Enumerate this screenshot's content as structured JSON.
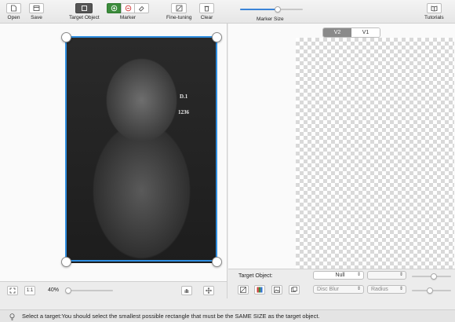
{
  "toolbar": {
    "open_label": "Open",
    "save_label": "Save",
    "target_object_label": "Target Object",
    "marker_label": "Marker",
    "fine_tuning_label": "Fine-tuning",
    "clear_label": "Clear",
    "marker_size_label": "Marker Size",
    "tutorials_label": "Tutorials",
    "marker_size_value": 0.6
  },
  "canvas": {
    "photo_labels": [
      "D.1",
      "1236"
    ]
  },
  "preview": {
    "tabs": [
      {
        "label": "V2",
        "active": true
      },
      {
        "label": "V1",
        "active": false
      }
    ]
  },
  "left_bottom": {
    "fit_label": "1:1",
    "zoom_label": "40%",
    "zoom_value": 0.05
  },
  "right_bottom": {
    "target_object_label": "Target Object:",
    "target_value": "Null",
    "blur_value": "Disc Blur",
    "radius_value": "Radius",
    "slider1_value": 0.55,
    "slider2_value": 0.45
  },
  "status": {
    "message": "Select a target:You should select the smallest possible rectangle that must be the SAME SIZE as the target object."
  },
  "colors": {
    "accent": "#2f8ee0",
    "marker_green": "#3c8c3c"
  }
}
